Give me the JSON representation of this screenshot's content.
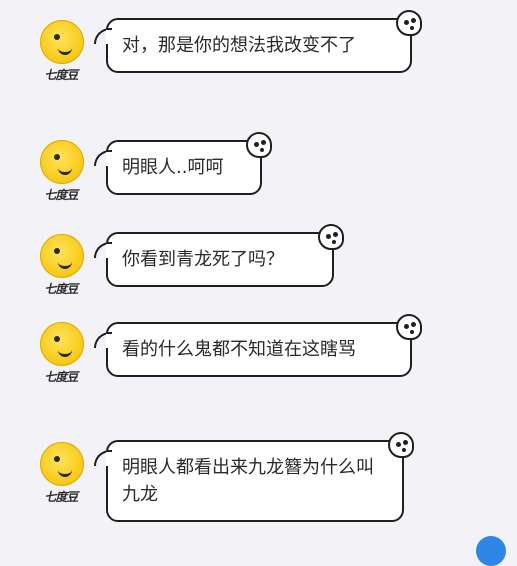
{
  "avatar": {
    "logo_text": "七度豆"
  },
  "messages": [
    {
      "text": "对，那是你的想法我改变不了"
    },
    {
      "text": "明眼人..呵呵"
    },
    {
      "text": "你看到青龙死了吗？"
    },
    {
      "text": "看的什么鬼都不知道在这瞎骂"
    },
    {
      "text": "明眼人都看出来九龙簪为什么叫九龙"
    }
  ],
  "colors": {
    "background": "#f3f3f7",
    "bubble_fill": "#ffffff",
    "bubble_border": "#1f1f1f",
    "avatar_yellow": "#f7c814",
    "indicator_blue": "#2f86e6"
  },
  "icons": {
    "avatar": "yellow-smiley-avatar-icon",
    "bubble_decoration": "ghost-peek-icon",
    "partial_indicator": "blue-circle-icon"
  }
}
